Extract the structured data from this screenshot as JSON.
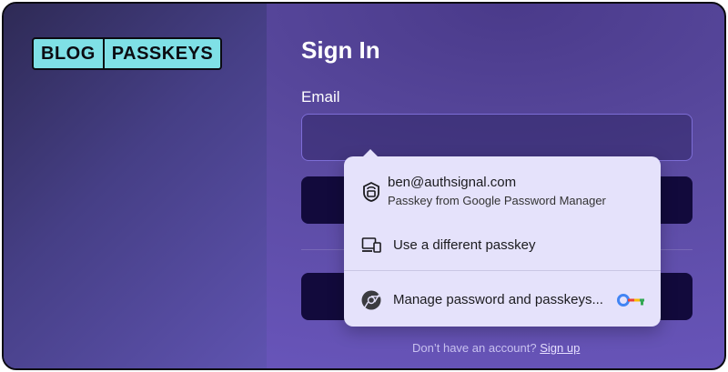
{
  "logo": {
    "left": "BLOG",
    "right": "PASSKEYS"
  },
  "form": {
    "title": "Sign In",
    "email_label": "Email",
    "signup_prefix": "Don’t have an account?",
    "signup_link": "Sign up"
  },
  "popup": {
    "account_email": "ben@authsignal.com",
    "account_source": "Passkey from Google Password Manager",
    "other_passkey": "Use a different passkey",
    "manage": "Manage password and passkeys..."
  },
  "colors": {
    "logo_bg": "#7fe0e6",
    "button_bg": "#120a3c",
    "popup_bg": "#e5e2fb",
    "accent_border": "#7d6dd6"
  },
  "icons": {
    "account": "passkey-lock-icon",
    "devices": "devices-icon",
    "browser": "chrome-icon",
    "key": "google-key-icon"
  }
}
